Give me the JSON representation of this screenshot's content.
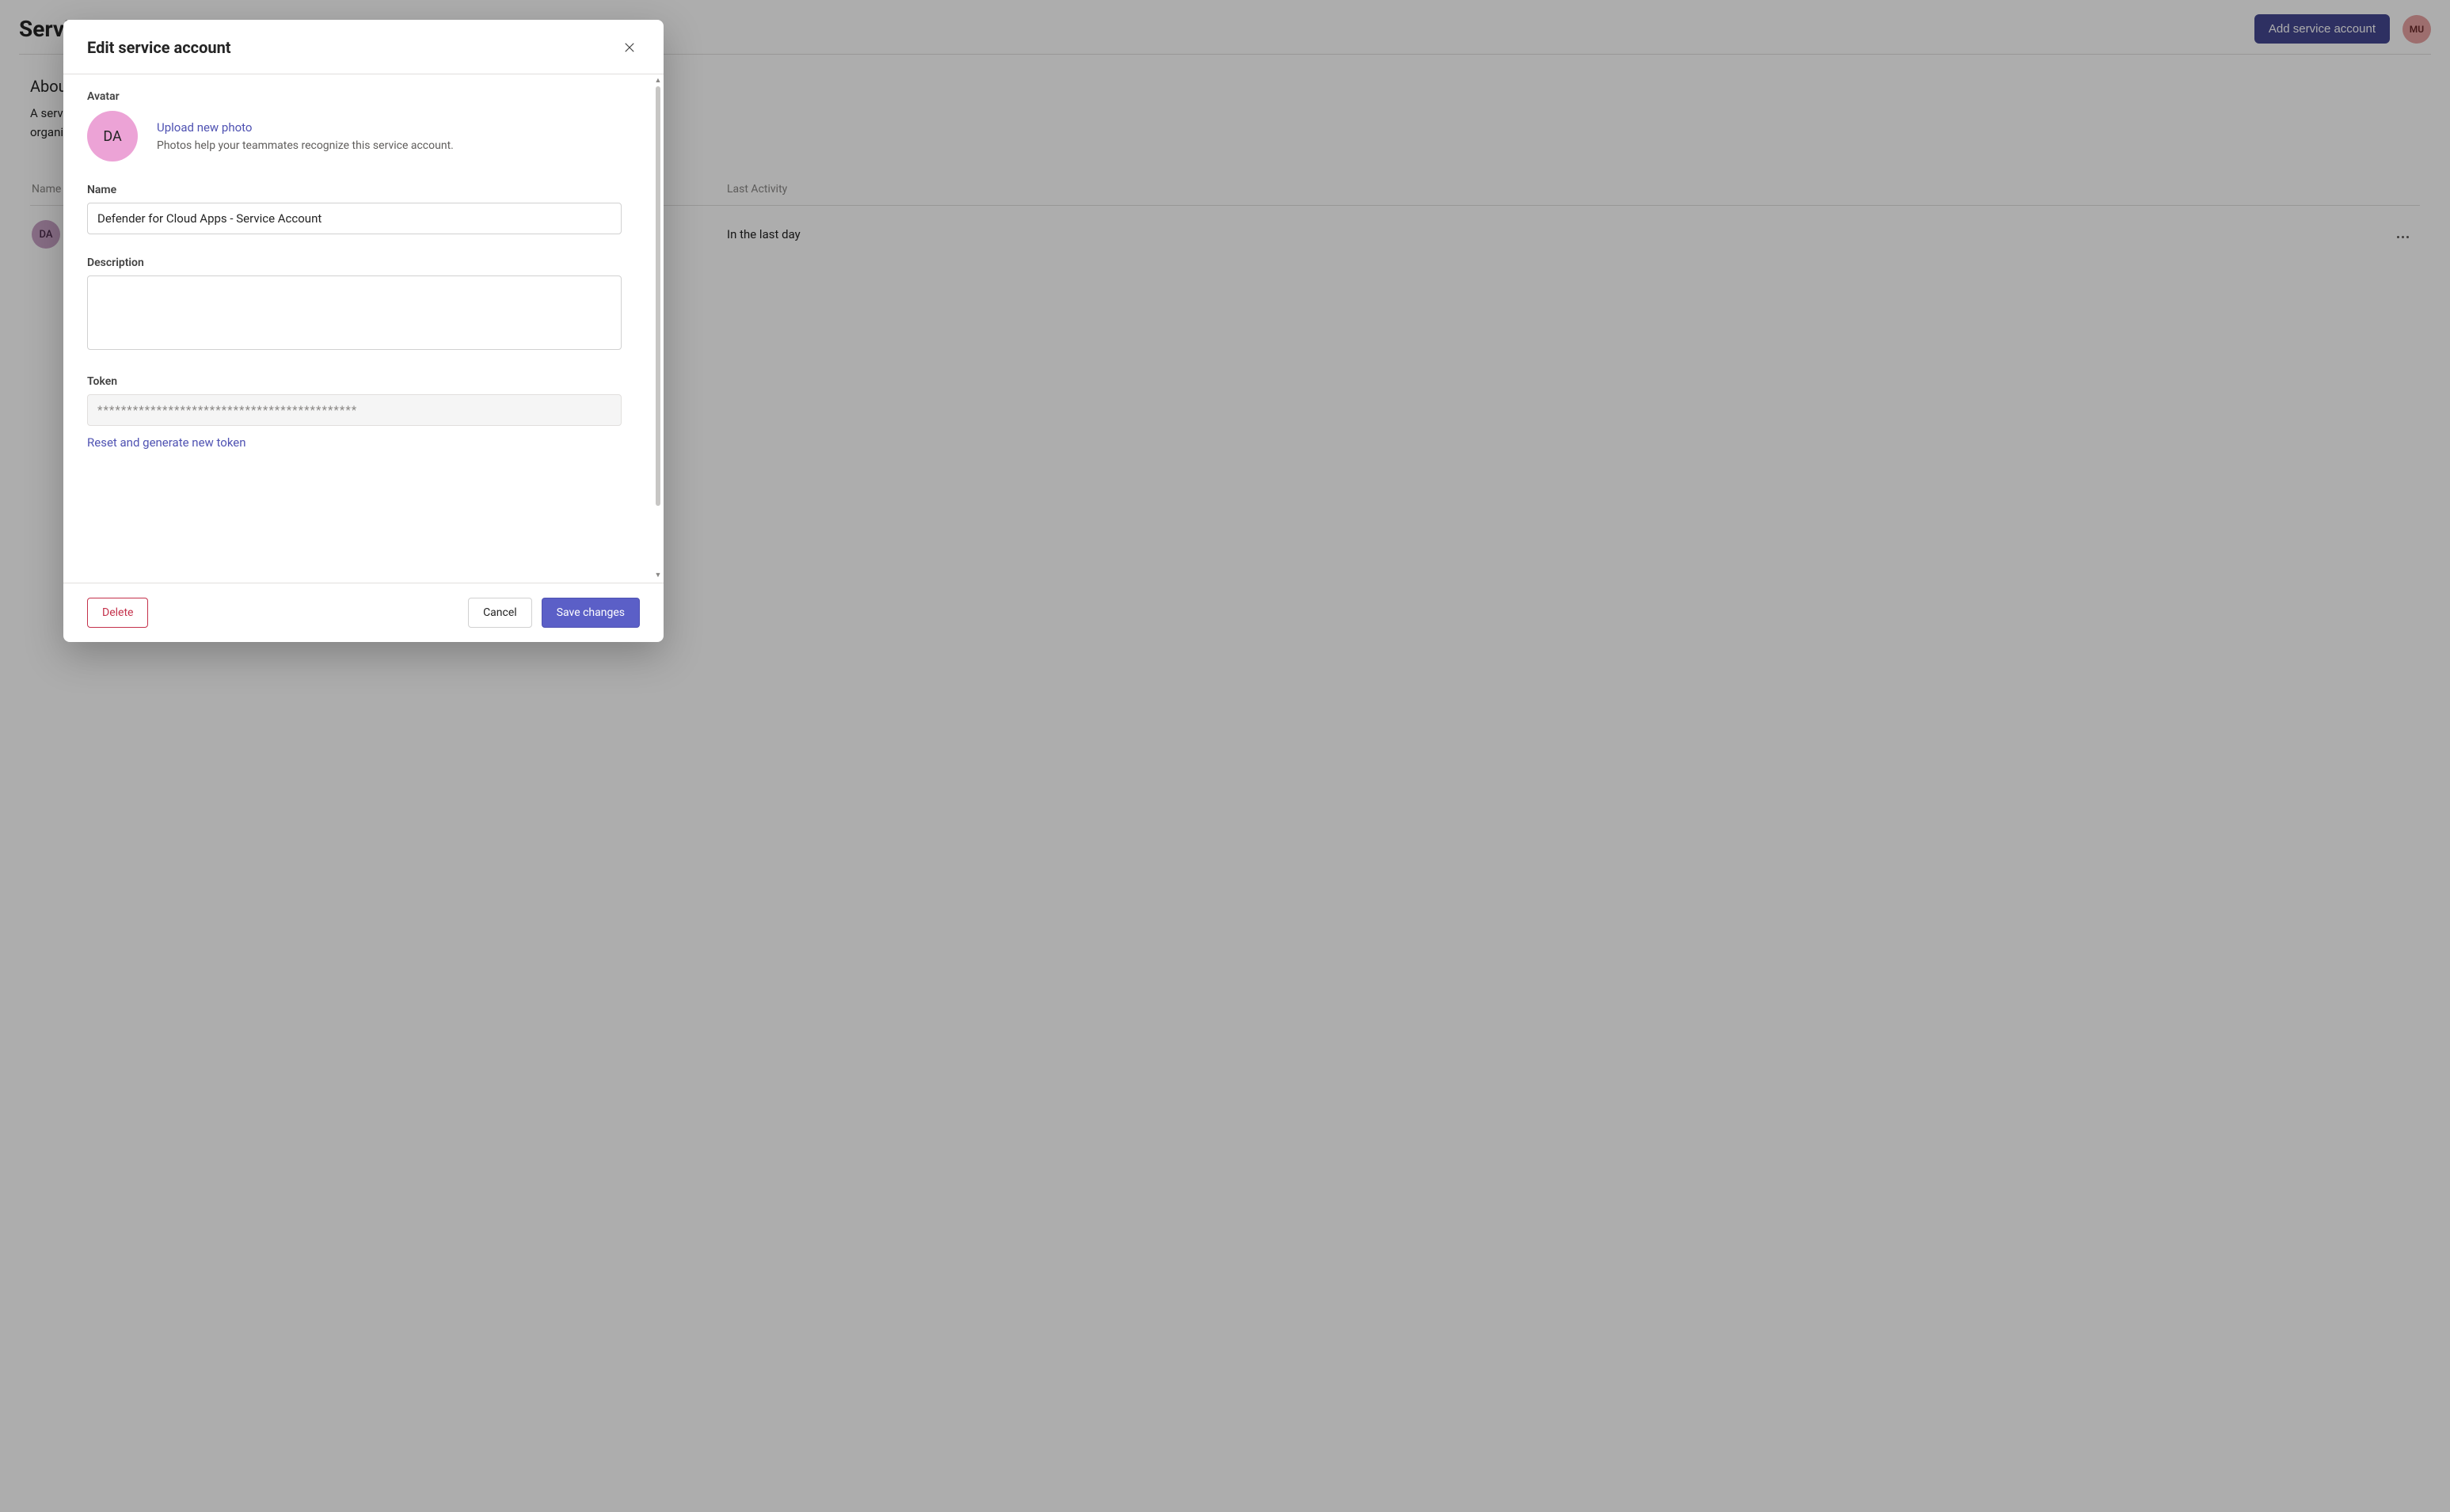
{
  "page": {
    "title": "Service accounts",
    "add_button": "Add service account",
    "user_avatar_initials": "MU",
    "about": {
      "heading": "About service accounts",
      "body_visible_frag1": "A service account",
      "body_visible_frag2": "organization. All admins can view active service accounts and"
    },
    "table": {
      "col_name": "Name",
      "col_activity": "Last Activity",
      "rows": [
        {
          "avatar": "DA",
          "activity": "In the last day"
        }
      ]
    }
  },
  "modal": {
    "title": "Edit service account",
    "avatar_label": "Avatar",
    "avatar_initials": "DA",
    "upload_link": "Upload new photo",
    "upload_hint": "Photos help your teammates recognize this service account.",
    "name_label": "Name",
    "name_value": "Defender for Cloud Apps - Service Account",
    "description_label": "Description",
    "description_value": "",
    "token_label": "Token",
    "token_value": "********************************************",
    "reset_token_link": "Reset and generate new token",
    "delete_button": "Delete",
    "cancel_button": "Cancel",
    "save_button": "Save changes"
  }
}
